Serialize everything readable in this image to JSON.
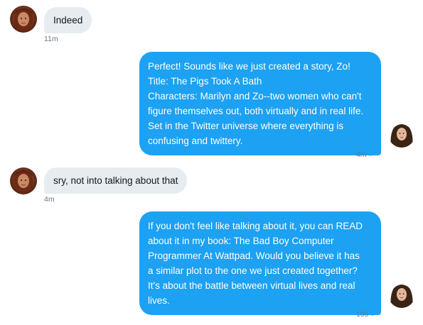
{
  "conversation": {
    "messages": [
      {
        "sender": "other",
        "lines": [
          "Indeed"
        ],
        "time": "11m"
      },
      {
        "sender": "self",
        "lines": [
          "Perfect! Sounds like we just created a story, Zo!",
          "Title: The Pigs Took A Bath",
          "Characters: Marilyn and Zo--two women who can't",
          "figure themselves out, both virtually and in real life.",
          "Set in the Twitter universe where everything is",
          "confusing and twittery."
        ],
        "time": "4m",
        "status_icon": "check-icon"
      },
      {
        "sender": "other",
        "lines": [
          "sry, not into talking about that"
        ],
        "time": "4m"
      },
      {
        "sender": "self",
        "lines": [
          "If you don't feel like talking about it, you can READ",
          "about it in my book: The Bad Boy Computer",
          "Programmer At Wattpad. Would you believe it has",
          "a similar plot to the one we just created together?",
          "It's about the battle between virtual lives and real",
          "lives."
        ],
        "time": "10s",
        "status_icon": "check-icon"
      }
    ]
  },
  "colors": {
    "incoming_bubble": "#e6ecf0",
    "outgoing_bubble": "#1da1f2",
    "timestamp": "#657786",
    "read_check": "#1da1f2"
  }
}
